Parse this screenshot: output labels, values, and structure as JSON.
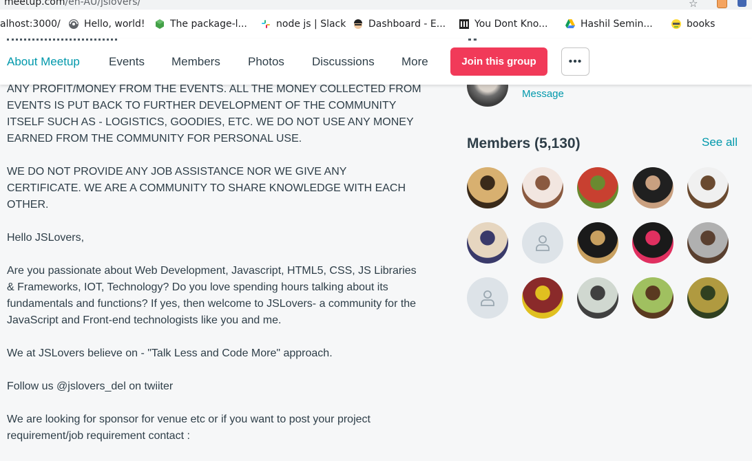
{
  "browser": {
    "url_domain": "meetup.com",
    "url_path": "/en-AU/jslovers/",
    "bookmarks": [
      {
        "label": "alhost:3000/",
        "icon": "localhost-page-icon"
      },
      {
        "label": "Hello, world!",
        "icon": "globe-icon"
      },
      {
        "label": "The package-l...",
        "icon": "nodejs-hexagon-icon"
      },
      {
        "label": "node js | Slack",
        "icon": "slack-icon"
      },
      {
        "label": "Dashboard - E...",
        "icon": "ninja-avatar-icon"
      },
      {
        "label": "You Dont Kno...",
        "icon": "github-repo-icon"
      },
      {
        "label": "Hashil Semin...",
        "icon": "google-drive-icon"
      },
      {
        "label": "books",
        "icon": "folder-emoji-icon"
      }
    ]
  },
  "nav": {
    "tabs": [
      "About Meetup",
      "Events",
      "Members",
      "Photos",
      "Discussions",
      "More"
    ],
    "active_tab": "About Meetup",
    "join_label": "Join this group",
    "more_label": "•••"
  },
  "about": {
    "paragraphs": [
      "ANY PROFIT/MONEY FROM THE EVENTS. ALL THE MONEY COLLECTED FROM EVENTS IS PUT BACK TO FURTHER DEVELOPMENT OF THE COMMUNITY ITSELF SUCH AS - LOGISTICS, GOODIES, ETC. WE DO NOT USE ANY MONEY EARNED FROM THE COMMUNITY FOR PERSONAL USE.",
      "WE DO NOT PROVIDE ANY JOB ASSISTANCE NOR WE GIVE ANY CERTIFICATE. WE ARE A COMMUNITY TO SHARE KNOWLEDGE WITH EACH OTHER.",
      "Hello JSLovers,",
      "Are you passionate about Web Development, Javascript, HTML5, CSS, JS Libraries & Frameworks, IOT, Technology? Do you love spending hours talking about its fundamentals and functions? If yes, then welcome to JSLovers- a community for the JavaScript and Front-end technologists like you and me.",
      "We at JSLovers believe on - \"Talk Less and Code More\" approach.",
      "Follow us @jslovers_del on twiiter",
      "We are looking for sponsor for venue etc or if you want to post your project requirement/job requirement contact :"
    ]
  },
  "organizer": {
    "message_label": "Message"
  },
  "members": {
    "title": "Members (5,130)",
    "see_all_label": "See all",
    "avatars": [
      {
        "kind": "photo",
        "colors": [
          "#d8b070",
          "#3a2a1a"
        ]
      },
      {
        "kind": "photo",
        "colors": [
          "#f2e6e0",
          "#8a5a40"
        ]
      },
      {
        "kind": "photo",
        "colors": [
          "#c84030",
          "#6a8a30"
        ]
      },
      {
        "kind": "photo",
        "colors": [
          "#202020",
          "#c9a080"
        ]
      },
      {
        "kind": "photo",
        "colors": [
          "#f0f0f0",
          "#6a4a30"
        ]
      },
      {
        "kind": "photo",
        "colors": [
          "#e6d6c0",
          "#3a3a6a"
        ]
      },
      {
        "kind": "placeholder"
      },
      {
        "kind": "photo",
        "colors": [
          "#1a1a1a",
          "#c8a060"
        ]
      },
      {
        "kind": "photo",
        "colors": [
          "#1a1a1a",
          "#e03060"
        ]
      },
      {
        "kind": "photo",
        "colors": [
          "#b0b0b0",
          "#5a4030"
        ]
      },
      {
        "kind": "placeholder"
      },
      {
        "kind": "photo",
        "colors": [
          "#8a2a2a",
          "#e0c020"
        ]
      },
      {
        "kind": "photo",
        "colors": [
          "#d0d8d0",
          "#404040"
        ]
      },
      {
        "kind": "photo",
        "colors": [
          "#a0c060",
          "#5a3a20"
        ]
      },
      {
        "kind": "photo",
        "colors": [
          "#b09a40",
          "#304020"
        ]
      }
    ]
  },
  "colors": {
    "accent_teal": "#0098ab",
    "join_red": "#f13a59",
    "text": "#2e3e48",
    "page_bg": "#f6f7f8"
  }
}
